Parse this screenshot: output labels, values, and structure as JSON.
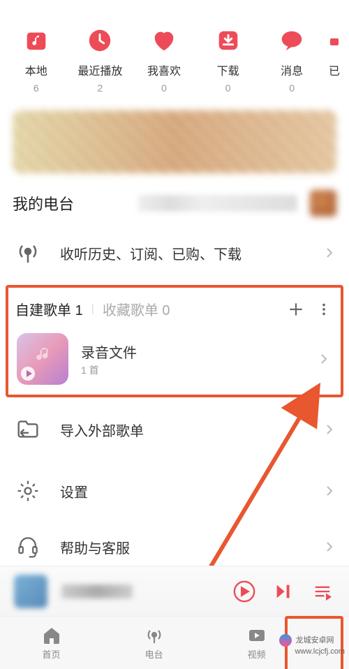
{
  "topCategories": [
    {
      "label": "本地",
      "count": "6"
    },
    {
      "label": "最近播放",
      "count": "2"
    },
    {
      "label": "我喜欢",
      "count": "0"
    },
    {
      "label": "下载",
      "count": "0"
    },
    {
      "label": "消息",
      "count": "0"
    },
    {
      "label": "已",
      "count": ""
    }
  ],
  "radio": {
    "title": "我的电台",
    "history": "收听历史、订阅、已购、下载"
  },
  "playlists": {
    "tab1Label": "自建歌单",
    "tab1Count": "1",
    "tab2Label": "收藏歌单",
    "tab2Count": "0",
    "item": {
      "title": "录音文件",
      "subtitle": "1 首"
    }
  },
  "menu": {
    "import": "导入外部歌单",
    "settings": "设置",
    "help": "帮助与客服"
  },
  "bottomNav": [
    {
      "label": "首页"
    },
    {
      "label": "电台"
    },
    {
      "label": "视频"
    }
  ],
  "watermark": {
    "brand": "龙城安卓网",
    "url": "www.lcjcfj.com"
  }
}
